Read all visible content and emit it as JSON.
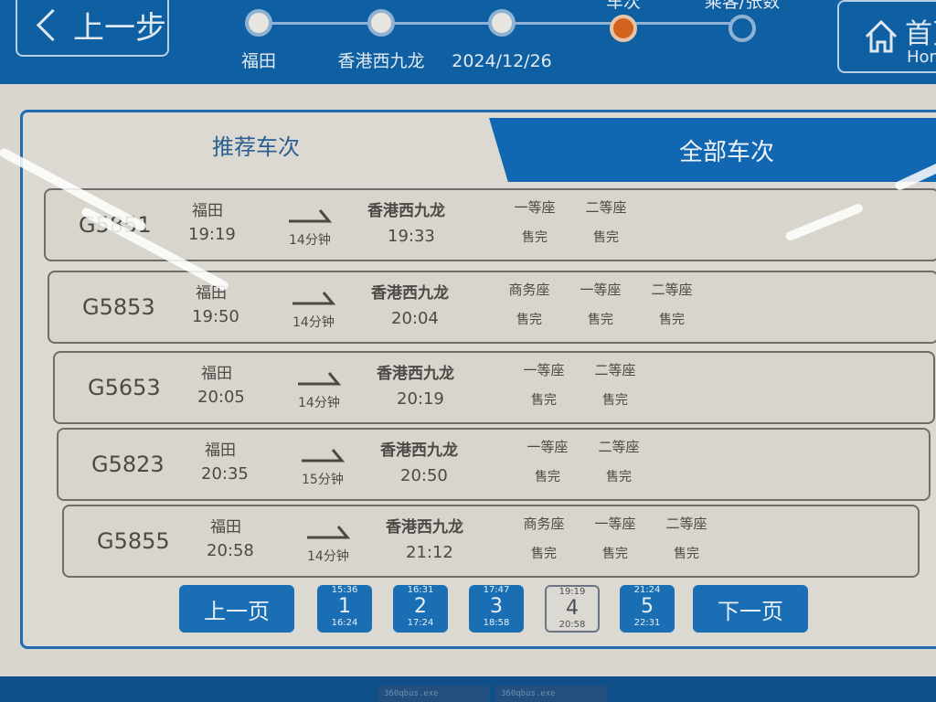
{
  "header": {
    "back_label": "上一步",
    "home_label_zh": "首页",
    "home_label_en": "Home",
    "steps": [
      {
        "label": "福田",
        "state": "done"
      },
      {
        "label": "香港西九龙",
        "state": "done"
      },
      {
        "label": "2024/12/26",
        "state": "done"
      },
      {
        "label": "车次",
        "state": "current"
      },
      {
        "label": "乘客/张数",
        "state": "todo"
      }
    ]
  },
  "tabs": [
    {
      "label": "推荐车次",
      "active": true
    },
    {
      "label": "全部车次",
      "active": false
    }
  ],
  "trains": [
    {
      "number": "G5851",
      "from": "福田",
      "depart": "19:19",
      "duration": "14分钟",
      "to": "香港西九龙",
      "arrive": "19:33",
      "seats": [
        {
          "class": "一等座",
          "status": "售完"
        },
        {
          "class": "二等座",
          "status": "售完"
        }
      ]
    },
    {
      "number": "G5853",
      "from": "福田",
      "depart": "19:50",
      "duration": "14分钟",
      "to": "香港西九龙",
      "arrive": "20:04",
      "seats": [
        {
          "class": "商务座",
          "status": "售完"
        },
        {
          "class": "一等座",
          "status": "售完"
        },
        {
          "class": "二等座",
          "status": "售完"
        }
      ]
    },
    {
      "number": "G5653",
      "from": "福田",
      "depart": "20:05",
      "duration": "14分钟",
      "to": "香港西九龙",
      "arrive": "20:19",
      "seats": [
        {
          "class": "一等座",
          "status": "售完"
        },
        {
          "class": "二等座",
          "status": "售完"
        }
      ]
    },
    {
      "number": "G5823",
      "from": "福田",
      "depart": "20:35",
      "duration": "15分钟",
      "to": "香港西九龙",
      "arrive": "20:50",
      "seats": [
        {
          "class": "一等座",
          "status": "售完"
        },
        {
          "class": "二等座",
          "status": "售完"
        }
      ]
    },
    {
      "number": "G5855",
      "from": "福田",
      "depart": "20:58",
      "duration": "14分钟",
      "to": "香港西九龙",
      "arrive": "21:12",
      "seats": [
        {
          "class": "商务座",
          "status": "售完"
        },
        {
          "class": "一等座",
          "status": "售完"
        },
        {
          "class": "二等座",
          "status": "售完"
        }
      ]
    }
  ],
  "pager": {
    "prev_label": "上一页",
    "next_label": "下一页",
    "pages": [
      {
        "num": "1",
        "start": "15:36",
        "end": "16:24",
        "current": false
      },
      {
        "num": "2",
        "start": "16:31",
        "end": "17:24",
        "current": false
      },
      {
        "num": "3",
        "start": "17:47",
        "end": "18:58",
        "current": false
      },
      {
        "num": "4",
        "start": "19:19",
        "end": "20:58",
        "current": true
      },
      {
        "num": "5",
        "start": "21:24",
        "end": "22:31",
        "current": false
      }
    ]
  },
  "taskbar": {
    "items": [
      "360qbus.exe",
      "360qbus.exe"
    ]
  },
  "colors": {
    "brand_blue": "#0f5fa3",
    "current_step": "#d2621d"
  }
}
